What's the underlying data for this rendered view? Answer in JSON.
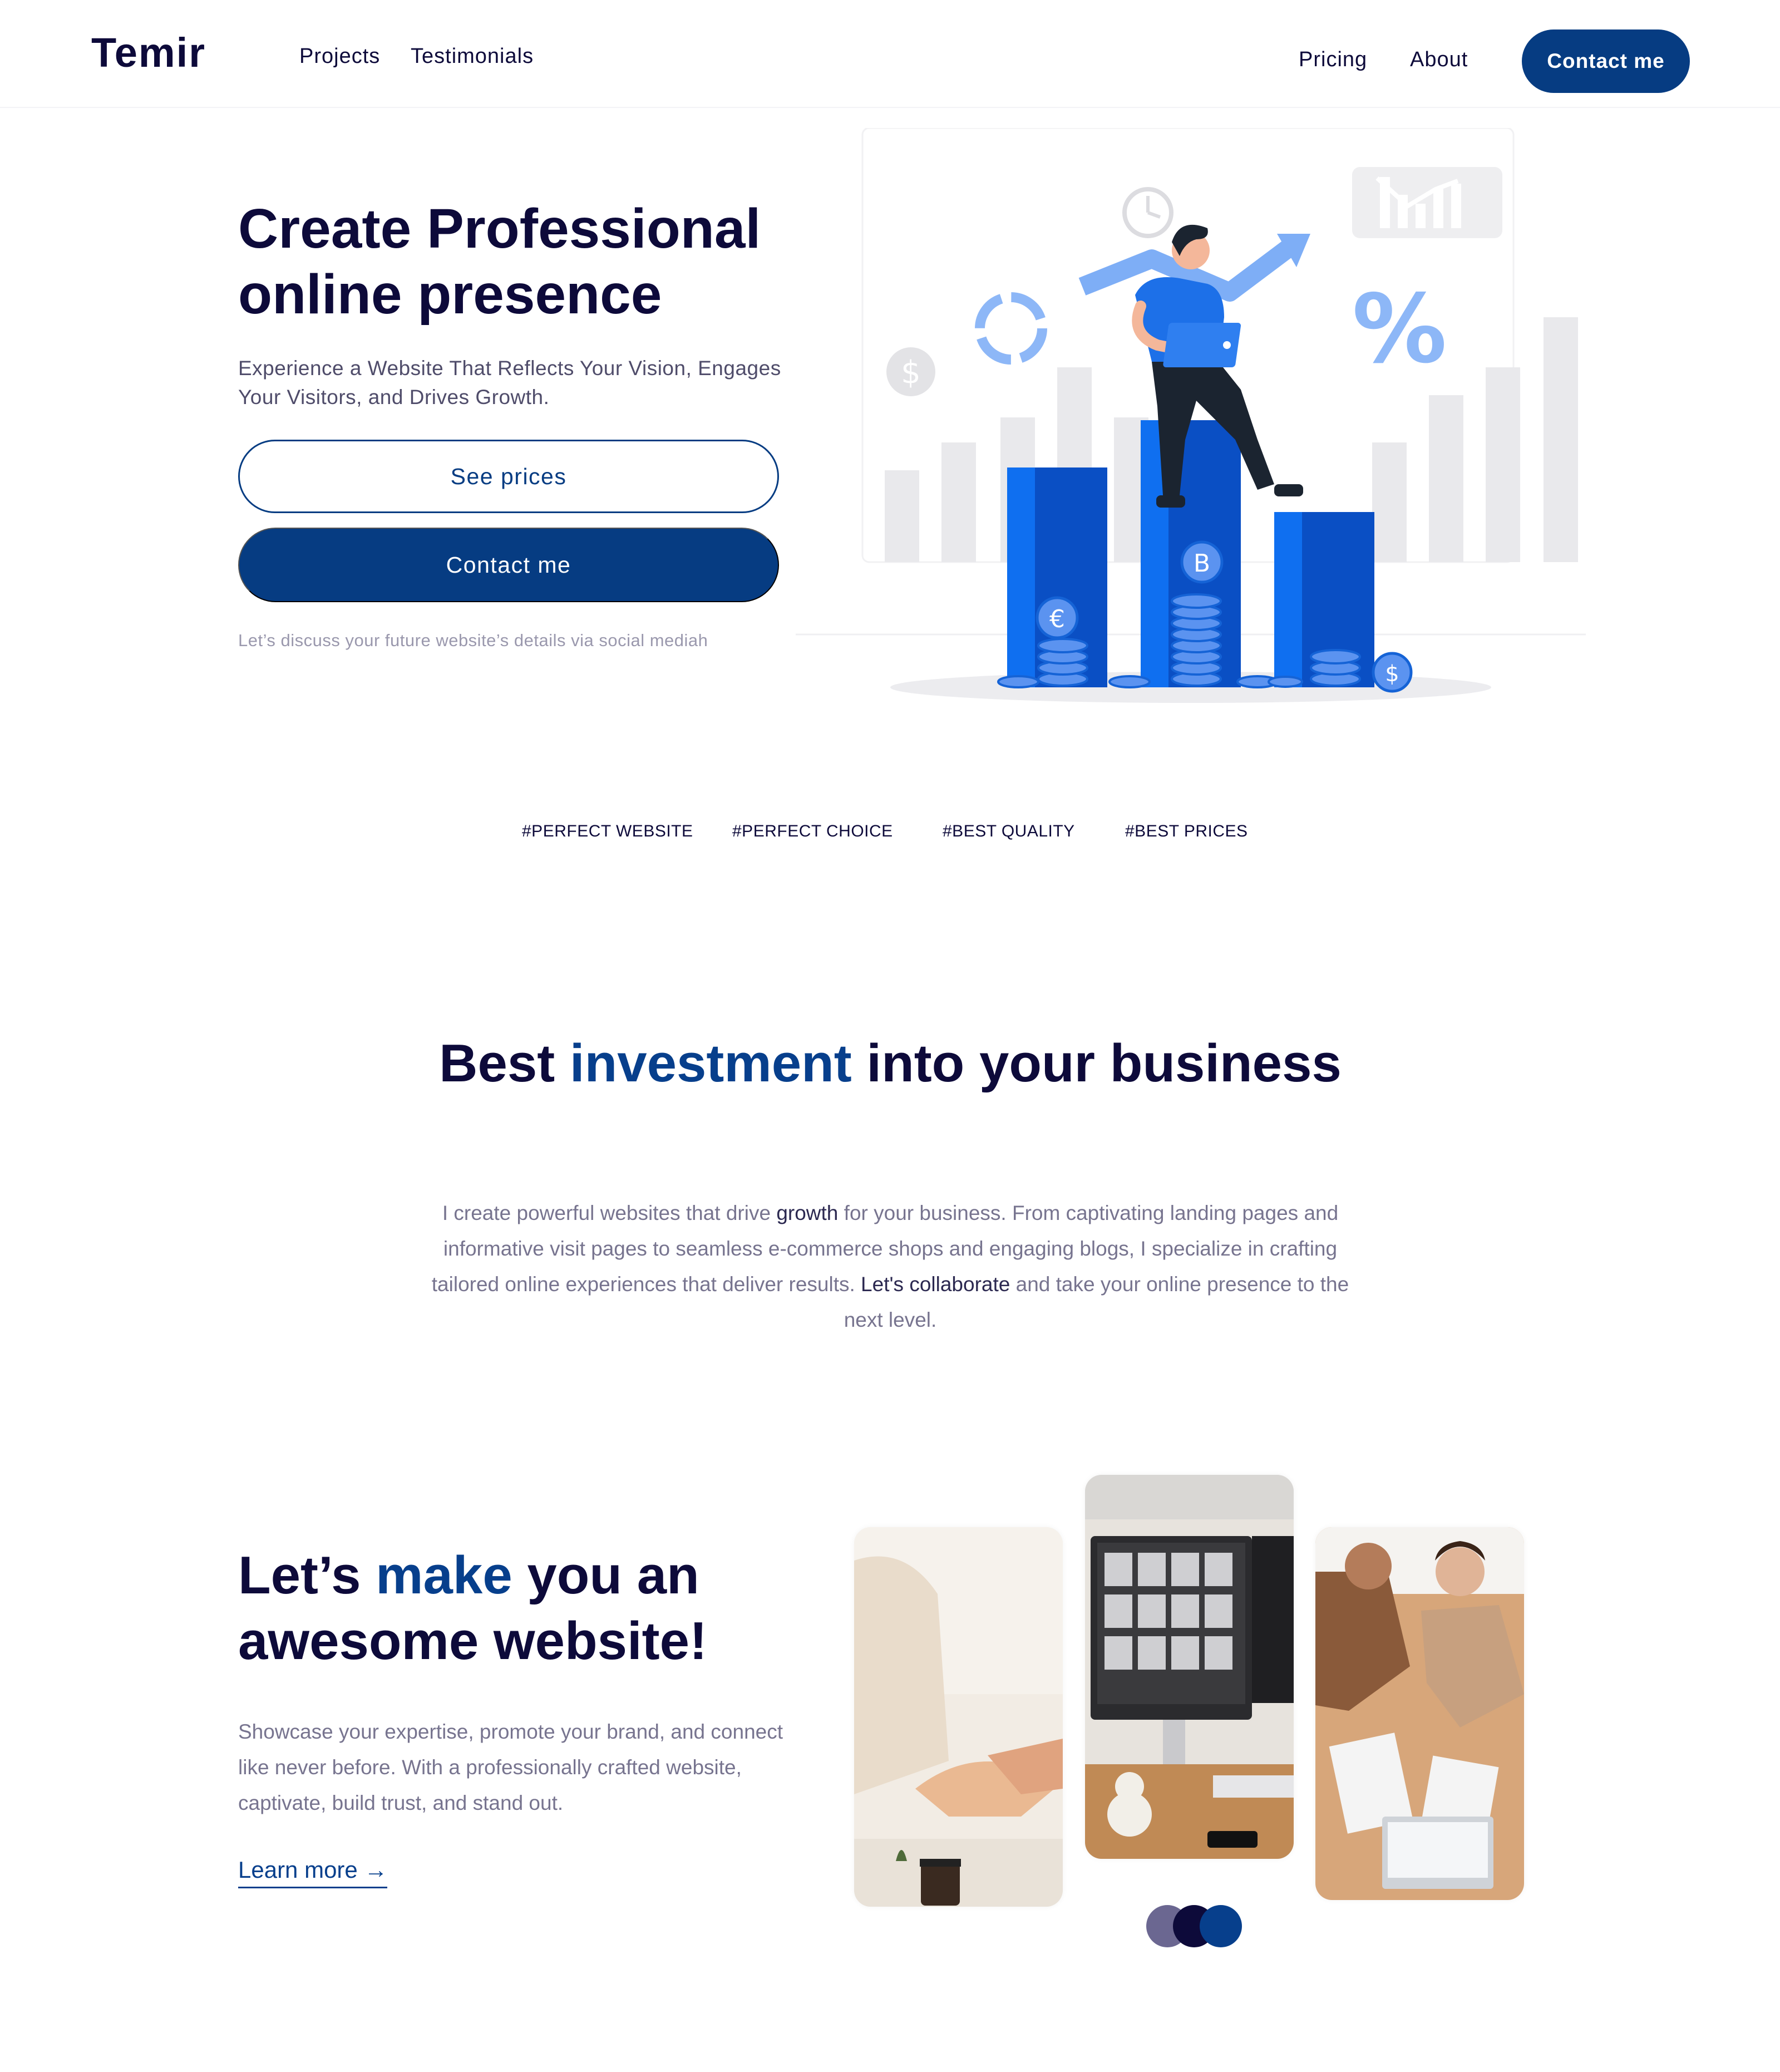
{
  "header": {
    "logo": "Temir",
    "nav": [
      "Projects",
      "Testimonials",
      "Pricing",
      "About"
    ],
    "cta": "Contact me"
  },
  "hero": {
    "title_line1": "Create Professional",
    "title_line2": "online presence",
    "subtitle": "Experience a Website That Reflects Your Vision, Engages Your Visitors, and Drives Growth.",
    "see_prices": "See prices",
    "contact": "Contact me",
    "note": "Let’s discuss your future website’s details via social mediah",
    "illustration": "person-on-bar-chart-with-coins"
  },
  "tags": [
    "#PERFECT WEBSITE",
    "#PERFECT CHOICE",
    "#BEST QUALITY",
    "#BEST PRICES"
  ],
  "investment": {
    "title_pre": "Best ",
    "title_accent": "investment",
    "title_post": " into your business",
    "body_1": "I create powerful websites that drive ",
    "body_b1": "growth",
    "body_2": " for your business. From captivating landing pages and informative visit pages to seamless e-commerce shops and engaging blogs, I specialize in crafting tailored online experiences that deliver results. ",
    "body_b2": "Let's collaborate",
    "body_3": " and take your online presence to the next level."
  },
  "website": {
    "title_pre": "Let’s ",
    "title_accent": "make",
    "title_post": " you an awesome website!",
    "body": "Showcase your expertise, promote your brand, and connect like never before. With a professionally crafted website, captivate, build trust, and stand out.",
    "link": "Learn more →",
    "photos": [
      "handshake-photo",
      "computer-monitor-photo",
      "team-meeting-photo"
    ]
  },
  "colors": {
    "navy": "#063c82",
    "ink": "#0d0a3a",
    "blue_bar": "#0f6ff0",
    "dot1": "#6b6791",
    "dot2": "#0d0a3a",
    "dot3": "#073f8c"
  }
}
